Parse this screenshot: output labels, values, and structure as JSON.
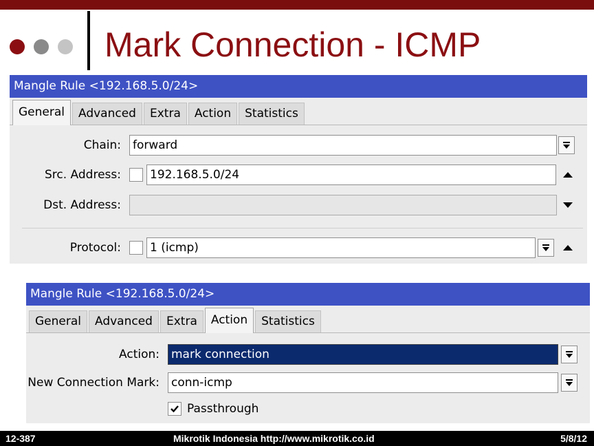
{
  "slide": {
    "title": "Mark Connection - ICMP",
    "bullet_colors": [
      "#8b0f12",
      "#8a8a8a",
      "#c4c4c4"
    ],
    "accent_color": "#7a0e0e"
  },
  "window1": {
    "title": "Mangle Rule <192.168.5.0/24>",
    "tabs": [
      "General",
      "Advanced",
      "Extra",
      "Action",
      "Statistics"
    ],
    "active_tab": "General",
    "chain": {
      "label": "Chain:",
      "value": "forward"
    },
    "src_address": {
      "label": "Src. Address:",
      "value": "192.168.5.0/24",
      "negate": false
    },
    "dst_address": {
      "label": "Dst. Address:",
      "value": ""
    },
    "protocol": {
      "label": "Protocol:",
      "value": "1 (icmp)",
      "negate": false
    }
  },
  "window2": {
    "title": "Mangle Rule <192.168.5.0/24>",
    "tabs": [
      "General",
      "Advanced",
      "Extra",
      "Action",
      "Statistics"
    ],
    "active_tab": "Action",
    "action": {
      "label": "Action:",
      "value": "mark connection"
    },
    "new_connection_mark": {
      "label": "New Connection Mark:",
      "value": "conn-icmp"
    },
    "passthrough": {
      "label": "Passthrough",
      "checked": true
    }
  },
  "footer": {
    "left": "12-387",
    "center": "Mikrotik Indonesia http://www.mikrotik.co.id",
    "right": "5/8/12"
  }
}
